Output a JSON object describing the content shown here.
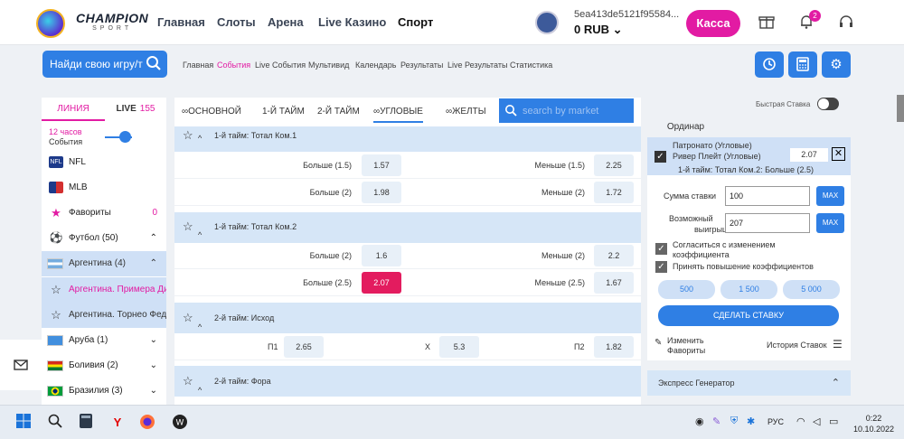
{
  "header": {
    "brand": "CHAMPION",
    "brand_sub": "SPORT",
    "nav": [
      "Главная",
      "Слоты",
      "Арена",
      "Live Казино",
      "Спорт"
    ],
    "account_id": "5ea413de5121f95584...",
    "balance": "0 RUB",
    "cashier": "Касса",
    "notif_count": "2"
  },
  "subheader": {
    "search_placeholder": "Найди свою игру/т",
    "links": [
      "Главная",
      "События",
      "Live События",
      "Мультивид",
      "Календарь",
      "Результаты",
      "Live Результаты",
      "Статистика"
    ],
    "active_link": "События"
  },
  "left_panel": {
    "tab_line": "ЛИНИЯ",
    "tab_live": "LIVE",
    "live_count": "155",
    "filter_hours": "12 часов",
    "filter_label": "События",
    "items": [
      {
        "label": "NFL",
        "right": ""
      },
      {
        "label": "MLB",
        "right": ""
      },
      {
        "label": "Фавориты",
        "right": "0"
      },
      {
        "label": "Футбол (50)",
        "right": "⌃"
      },
      {
        "label": "Аргентина (4)",
        "right": "⌃"
      },
      {
        "label": "Аргентина. Примера Дивизион",
        "right": ""
      },
      {
        "label": "Аргентина. Торнео Федерал",
        "right": ""
      },
      {
        "label": "Аруба (1)",
        "right": "⌄"
      },
      {
        "label": "Боливия (2)",
        "right": "⌄"
      },
      {
        "label": "Бразилия (3)",
        "right": "⌄"
      }
    ]
  },
  "center": {
    "tabs": [
      "ОСНОВНОЙ",
      "1-Й ТАЙМ",
      "2-Й ТАЙМ",
      "УГЛОВЫЕ",
      "ЖЕЛТЫ"
    ],
    "active_tab": "УГЛОВЫЕ",
    "search_placeholder": "search by market",
    "markets": [
      {
        "title": "1-й тайм: Тотал Ком.1",
        "rows": [
          {
            "l_label": "Больше (1.5)",
            "l_odd": "1.57",
            "r_label": "Меньше (1.5)",
            "r_odd": "2.25"
          },
          {
            "l_label": "Больше (2)",
            "l_odd": "1.98",
            "r_label": "Меньше (2)",
            "r_odd": "1.72"
          }
        ]
      },
      {
        "title": "1-й тайм: Тотал Ком.2",
        "rows": [
          {
            "l_label": "Больше (2)",
            "l_odd": "1.6",
            "r_label": "Меньше (2)",
            "r_odd": "2.2"
          },
          {
            "l_label": "Больше (2.5)",
            "l_odd": "2.07",
            "r_label": "Меньше (2.5)",
            "r_odd": "1.67"
          }
        ]
      },
      {
        "title": "2-й тайм: Исход",
        "three": [
          {
            "label": "П1",
            "odd": "2.65"
          },
          {
            "label": "X",
            "odd": "5.3"
          },
          {
            "label": "П2",
            "odd": "1.82"
          }
        ]
      },
      {
        "title": "2-й тайм: Фора"
      }
    ]
  },
  "bet_slip": {
    "quick_bet": "Быстрая Ставка",
    "tab": "Ординар",
    "event_line1": "Патронато (Угловые)",
    "event_line2": "Ривер Плейт (Угловые)",
    "market": "1-й тайм: Тотал Ком.2: Больше (2.5)",
    "coef": "2.07",
    "stake_label": "Сумма ставки",
    "stake_value": "100",
    "win_label1": "Возможный",
    "win_label2": "выигрыш",
    "win_value": "207",
    "max": "MAX",
    "agree1_a": "Согласиться с изменением",
    "agree1_b": "коэффициента",
    "agree2": "Принять повышение коэффициентов",
    "amounts": [
      "500",
      "1 500",
      "5 000"
    ],
    "make_bet": "СДЕЛАТЬ СТАВКУ",
    "edit_favs_a": "Изменить",
    "edit_favs_b": "Фавориты",
    "history": "История Ставок",
    "express": "Экспресс Генератор"
  },
  "taskbar": {
    "lang": "РУС",
    "time": "0:22",
    "date": "10.10.2022"
  }
}
